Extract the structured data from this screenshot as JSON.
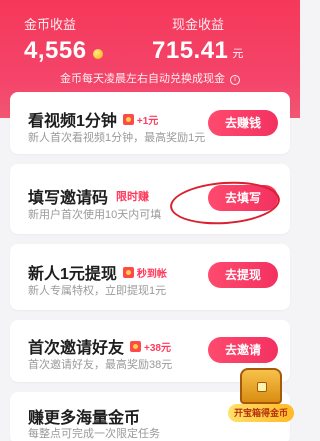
{
  "header": {
    "coin_label": "金币收益",
    "coin_value": "4,556",
    "cash_label": "现金收益",
    "cash_value": "715.41",
    "cash_unit": "元",
    "notice": "金币每天凌晨左右自动兑换成现金"
  },
  "tasks": [
    {
      "title": "看视频1分钟",
      "badge": "+1元",
      "desc": "新人首次看视频1分钟，最高奖励1元",
      "button": "去赚钱"
    },
    {
      "title": "填写邀请码",
      "tag": "限时赚",
      "desc": "新用户首次使用10天内可填",
      "button": "去填写"
    },
    {
      "title": "新人1元提现",
      "badge": "秒到帐",
      "desc": "新人专属特权，立即提现1元",
      "button": "去提现"
    },
    {
      "title": "首次邀请好友",
      "badge": "+38元",
      "desc": "首次邀请好友，最高奖励38元",
      "button": "去邀请"
    },
    {
      "title": "赚更多海量金币",
      "desc": "每整点可完成一次限定任务"
    }
  ],
  "treasure": {
    "label": "开宝箱得金币"
  },
  "icons": {
    "coin": "coin-icon",
    "info": "info-icon",
    "envelope": "red-envelope-icon",
    "chest": "treasure-chest-icon"
  },
  "colors": {
    "accent": "#f33160",
    "header": "#f5385a",
    "highlight": "#d9202e"
  }
}
